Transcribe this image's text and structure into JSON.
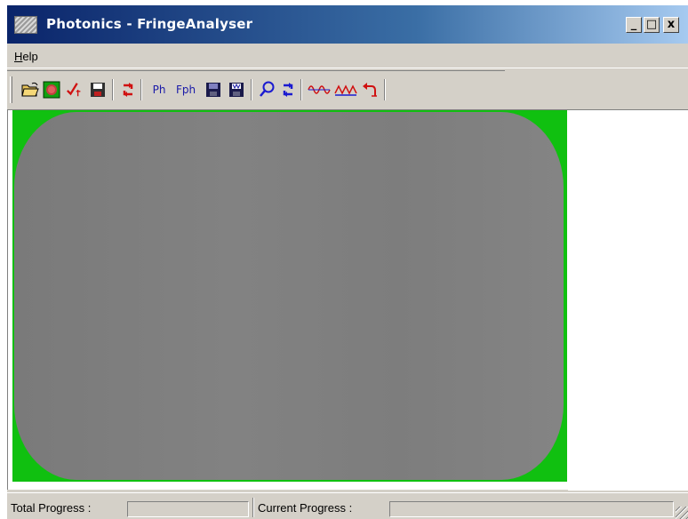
{
  "window": {
    "title": "Photonics - FringeAnalyser",
    "controls": {
      "minimize": "_",
      "maximize": "□",
      "close": "x"
    }
  },
  "menu": {
    "help_mnemonic": "H",
    "help_rest": "elp"
  },
  "toolbar": {
    "items": [
      {
        "icon": "open-folder-icon"
      },
      {
        "icon": "load-image-icon"
      },
      {
        "icon": "check-mark-icon"
      },
      {
        "icon": "save-disk-icon"
      },
      {
        "icon": "refresh-red-icon"
      },
      {
        "icon": "phase-icon",
        "label": "Ph"
      },
      {
        "icon": "fringe-phase-icon",
        "label": "Fph"
      },
      {
        "icon": "save-phase-icon"
      },
      {
        "icon": "save-wrapped-icon"
      },
      {
        "icon": "zoom-search-icon"
      },
      {
        "icon": "refresh-blue-icon"
      },
      {
        "icon": "sine-wave-icon"
      },
      {
        "icon": "triangle-wave-icon"
      },
      {
        "icon": "undo-rotate-icon"
      }
    ]
  },
  "colors": {
    "image_background": "#10c010",
    "fringe_area": "#808080",
    "title_bar": "#0a246a",
    "face": "#d4d0c8"
  },
  "status": {
    "total_label": "Total Progress :",
    "total_progress": 0,
    "current_label": "Current Progress :",
    "current_progress": 0
  }
}
